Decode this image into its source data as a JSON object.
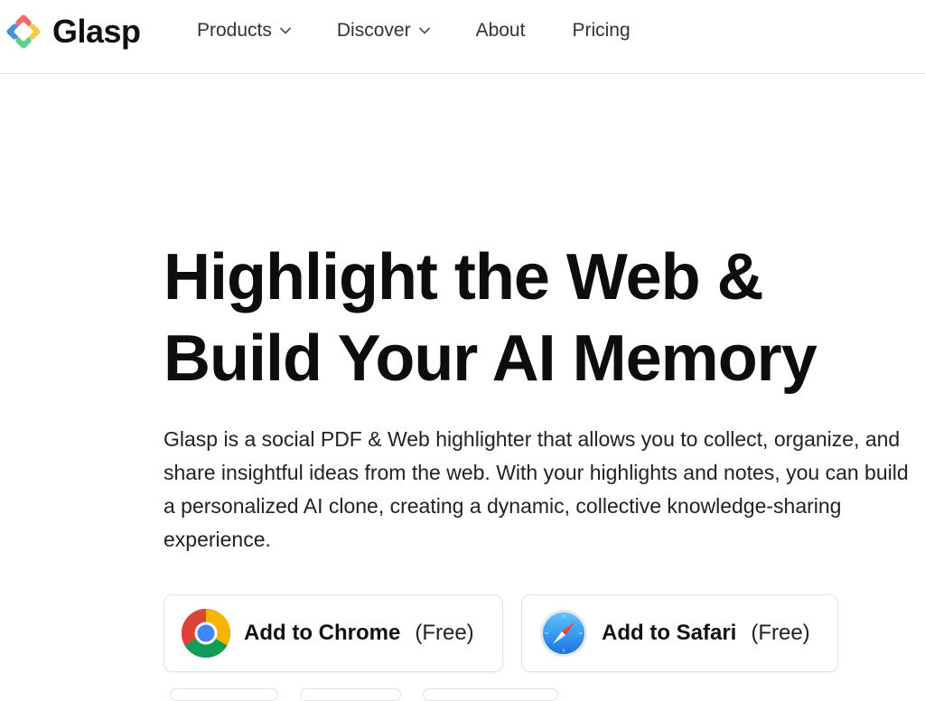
{
  "brand": {
    "name": "Glasp",
    "logo_icon": "glasp-diamond-logo-icon",
    "logo_colors": [
      "#f26b6b",
      "#f7c948",
      "#5bd18a",
      "#4a90e2"
    ]
  },
  "nav": {
    "items": [
      {
        "label": "Products",
        "icon": "chevron-down-icon"
      },
      {
        "label": "Discover",
        "icon": "chevron-down-icon"
      },
      {
        "label": "About"
      },
      {
        "label": "Pricing"
      }
    ]
  },
  "hero": {
    "title_line1": "Highlight the Web &",
    "title_line2": "Build Your AI Memory",
    "description": "Glasp is a social PDF & Web highlighter that allows you to collect, organize, and share insightful ideas from the web. With your highlights and notes, you can build a personalized AI clone, creating a dynamic, collective knowledge-sharing experience."
  },
  "cta": {
    "chrome": {
      "label": "Add to Chrome",
      "note": "(Free)",
      "icon": "chrome-icon"
    },
    "safari": {
      "label": "Add to Safari",
      "note": "(Free)",
      "icon": "safari-compass-icon"
    }
  },
  "colors": {
    "text": "#111111",
    "border": "#e3e3e3",
    "background": "#ffffff"
  }
}
